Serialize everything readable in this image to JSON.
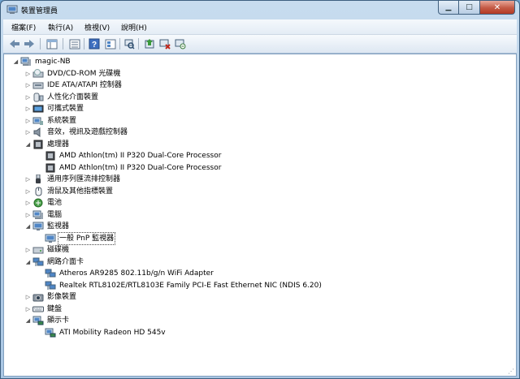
{
  "window": {
    "title": "裝置管理員"
  },
  "menu": [
    {
      "label": "檔案(F)"
    },
    {
      "label": "執行(A)"
    },
    {
      "label": "檢視(V)"
    },
    {
      "label": "說明(H)"
    }
  ],
  "toolbar": [
    "back",
    "forward",
    "properties-pane",
    "view-list",
    "help",
    "view-all",
    "scan-hardware",
    "update-driver",
    "disable-device",
    "uninstall-device"
  ],
  "tree": [
    {
      "label": "magic-NB",
      "level": 0,
      "arrow": "expanded",
      "icon": "computer-icon"
    },
    {
      "label": "DVD/CD-ROM 光碟機",
      "level": 1,
      "arrow": "collapsed",
      "icon": "dvd-drive-icon"
    },
    {
      "label": "IDE ATA/ATAPI 控制器",
      "level": 1,
      "arrow": "collapsed",
      "icon": "ide-controller-icon"
    },
    {
      "label": "人性化介面裝置",
      "level": 1,
      "arrow": "collapsed",
      "icon": "hid-icon"
    },
    {
      "label": "可攜式裝置",
      "level": 1,
      "arrow": "collapsed",
      "icon": "portable-device-icon"
    },
    {
      "label": "系統裝置",
      "level": 1,
      "arrow": "collapsed",
      "icon": "system-device-icon"
    },
    {
      "label": "音效，視訊及遊戲控制器",
      "level": 1,
      "arrow": "collapsed",
      "icon": "speaker-icon"
    },
    {
      "label": "處理器",
      "level": 1,
      "arrow": "expanded",
      "icon": "processor-icon"
    },
    {
      "label": "AMD Athlon(tm) II P320 Dual-Core Processor",
      "level": 2,
      "arrow": "none",
      "icon": "processor-icon"
    },
    {
      "label": "AMD Athlon(tm) II P320 Dual-Core Processor",
      "level": 2,
      "arrow": "none",
      "icon": "processor-icon"
    },
    {
      "label": "通用序列匯流排控制器",
      "level": 1,
      "arrow": "collapsed",
      "icon": "usb-icon"
    },
    {
      "label": "滑鼠及其他指標裝置",
      "level": 1,
      "arrow": "collapsed",
      "icon": "mouse-icon"
    },
    {
      "label": "電池",
      "level": 1,
      "arrow": "collapsed",
      "icon": "battery-icon"
    },
    {
      "label": "電腦",
      "level": 1,
      "arrow": "collapsed",
      "icon": "computer-icon"
    },
    {
      "label": "監視器",
      "level": 1,
      "arrow": "expanded",
      "icon": "monitor-icon"
    },
    {
      "label": "一般 PnP 監視器",
      "level": 2,
      "arrow": "none",
      "icon": "monitor-icon",
      "selected": true
    },
    {
      "label": "磁碟機",
      "level": 1,
      "arrow": "collapsed",
      "icon": "disk-drive-icon"
    },
    {
      "label": "網路介面卡",
      "level": 1,
      "arrow": "expanded",
      "icon": "network-adapter-icon"
    },
    {
      "label": "Atheros AR9285 802.11b/g/n WiFi Adapter",
      "level": 2,
      "arrow": "none",
      "icon": "network-adapter-icon"
    },
    {
      "label": "Realtek RTL8102E/RTL8103E Family PCI-E Fast Ethernet NIC (NDIS 6.20)",
      "level": 2,
      "arrow": "none",
      "icon": "network-adapter-icon"
    },
    {
      "label": "影像裝置",
      "level": 1,
      "arrow": "collapsed",
      "icon": "camera-icon"
    },
    {
      "label": "鍵盤",
      "level": 1,
      "arrow": "collapsed",
      "icon": "keyboard-icon"
    },
    {
      "label": "顯示卡",
      "level": 1,
      "arrow": "expanded",
      "icon": "display-adapter-icon"
    },
    {
      "label": "ATI Mobility Radeon HD 545v",
      "level": 2,
      "arrow": "none",
      "icon": "display-adapter-icon"
    }
  ]
}
